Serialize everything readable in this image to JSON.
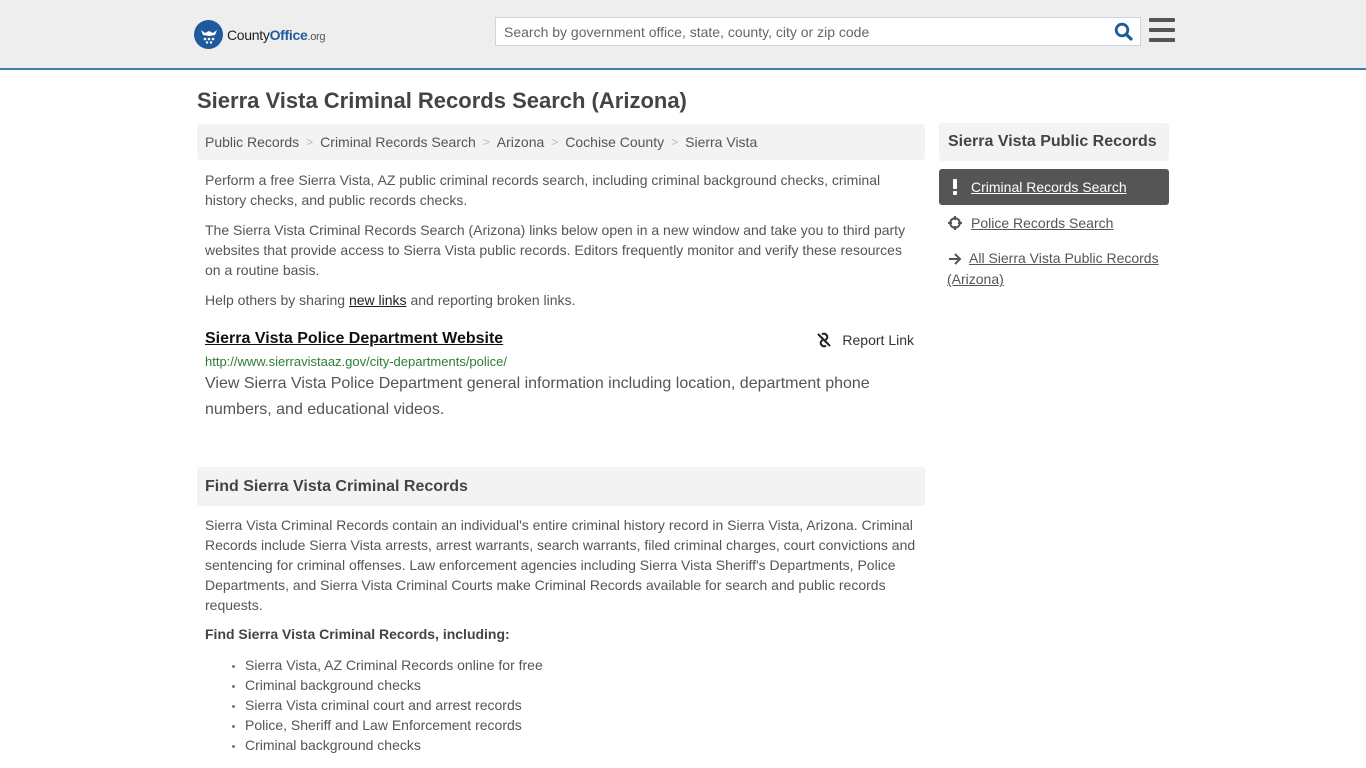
{
  "header": {
    "logo": {
      "name_a": "County",
      "name_b": "Office",
      "name_c": ".org"
    },
    "search": {
      "placeholder": "Search by government office, state, county, city or zip code",
      "value": ""
    },
    "icons": {
      "search": "search-icon",
      "menu": "hamburger-menu-icon"
    }
  },
  "page": {
    "title": "Sierra Vista Criminal Records Search (Arizona)"
  },
  "breadcrumb": [
    {
      "label": "Public Records"
    },
    {
      "label": "Criminal Records Search"
    },
    {
      "label": "Arizona"
    },
    {
      "label": "Cochise County"
    },
    {
      "label": "Sierra Vista"
    }
  ],
  "intro": {
    "p1": "Perform a free Sierra Vista, AZ public criminal records search, including criminal background checks, criminal history checks, and public records checks.",
    "p2": "The Sierra Vista Criminal Records Search (Arizona) links below open in a new window and take you to third party websites that provide access to Sierra Vista public records. Editors frequently monitor and verify these resources on a routine basis.",
    "p3_before": "Help others by sharing ",
    "p3_link": "new links",
    "p3_after": " and reporting broken links."
  },
  "links": [
    {
      "title": "Sierra Vista Police Department Website",
      "url": "http://www.sierravistaaz.gov/city-departments/police/",
      "description": "View Sierra Vista Police Department general information including location, department phone numbers, and educational videos.",
      "report_label": "Report Link"
    }
  ],
  "section": {
    "heading": "Find Sierra Vista Criminal Records",
    "body": "Sierra Vista Criminal Records contain an individual's entire criminal history record in Sierra Vista, Arizona. Criminal Records include Sierra Vista arrests, arrest warrants, search warrants, filed criminal charges, court convictions and sentencing for criminal offenses. Law enforcement agencies including Sierra Vista Sheriff's Departments, Police Departments, and Sierra Vista Criminal Courts make Criminal Records available for search and public records requests.",
    "subheading": "Find Sierra Vista Criminal Records, including:",
    "bullets": [
      "Sierra Vista, AZ Criminal Records online for free",
      "Criminal background checks",
      "Sierra Vista criminal court and arrest records",
      "Police, Sheriff and Law Enforcement records",
      "Criminal background checks"
    ]
  },
  "sidebar": {
    "heading": "Sierra Vista Public Records",
    "items": [
      {
        "label": "Criminal Records Search",
        "icon": "exclamation-icon",
        "active": true
      },
      {
        "label": "Police Records Search",
        "icon": "crosshair-icon",
        "active": false
      },
      {
        "label": "All Sierra Vista Public Records (Arizona)",
        "icon": "arrow-right-icon",
        "active": false
      }
    ]
  },
  "colors": {
    "accent": "#3a7fae",
    "brand": "#1f5a9e",
    "url_green": "#2e7d32",
    "active_bg": "#555555"
  }
}
